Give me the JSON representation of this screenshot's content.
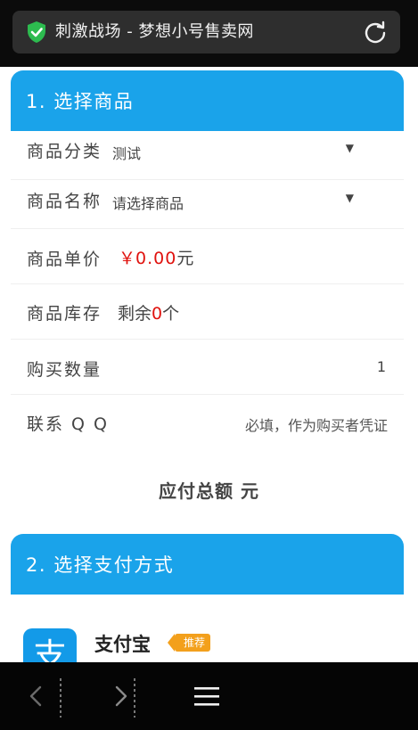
{
  "browser": {
    "page_title": "刺激战场 - 梦想小号售卖网"
  },
  "section1": {
    "header": "1. 选择商品",
    "category": {
      "label": "商品分类",
      "value": "测试"
    },
    "name": {
      "label": "商品名称",
      "value": "请选择商品"
    },
    "price": {
      "label": "商品单价",
      "currency": "￥",
      "amount": "0.00",
      "unit": "元"
    },
    "stock": {
      "label": "商品库存",
      "prefix": "剩余",
      "count": "0",
      "suffix": "个"
    },
    "quantity": {
      "label": "购买数量",
      "value": "1"
    },
    "qq": {
      "label": "联系 Q Q",
      "placeholder": "必填，作为购买者凭证"
    }
  },
  "total": {
    "label": "应付总额 元"
  },
  "section2": {
    "header": "2. 选择支付方式",
    "alipay": {
      "name": "支付宝",
      "badge": "推荐",
      "logo_char": "支"
    }
  },
  "colors": {
    "accent": "#1aa3ea",
    "price_red": "#e0120e",
    "badge_orange": "#f3a01c"
  }
}
